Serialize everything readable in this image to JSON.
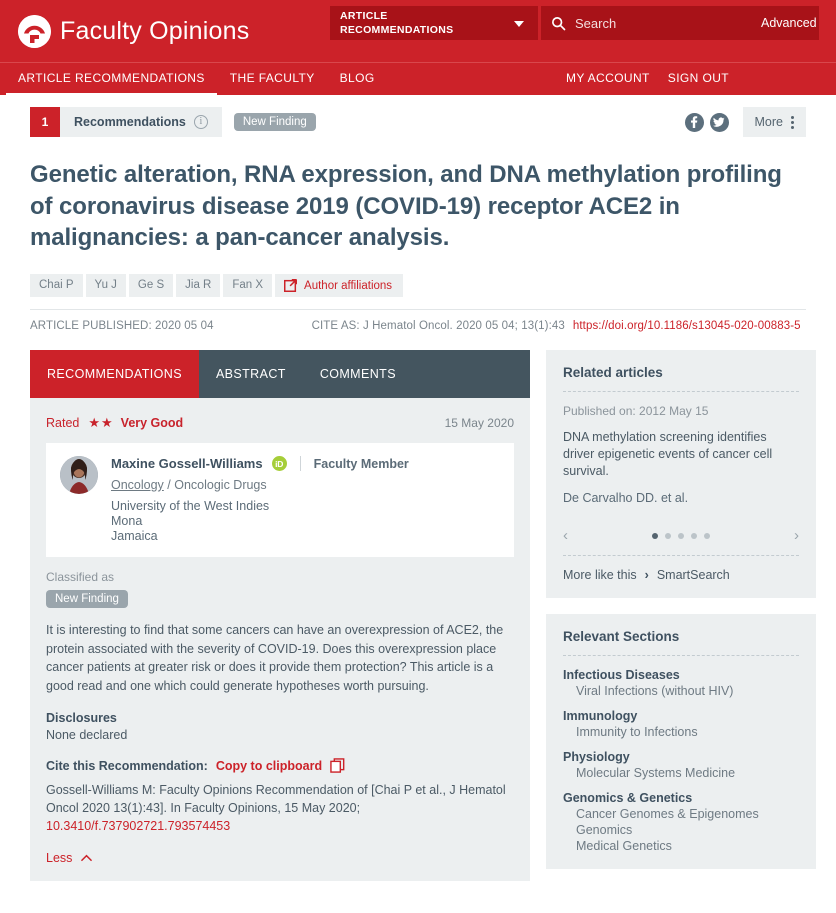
{
  "header": {
    "brand": "Faculty Opinions",
    "logo_icon": "faculty-opinions-logo",
    "dropdown": {
      "line1": "ARTICLE",
      "line2": "RECOMMENDATIONS",
      "caret_icon": "chevron-down-icon"
    },
    "search": {
      "icon": "search-icon",
      "placeholder": "Search",
      "value": "",
      "advanced_label": "Advanced"
    }
  },
  "nav": {
    "items": [
      {
        "label": "ARTICLE RECOMMENDATIONS",
        "active": true
      },
      {
        "label": "THE FACULTY",
        "active": false
      },
      {
        "label": "BLOG",
        "active": false
      }
    ],
    "account": [
      {
        "label": "MY ACCOUNT"
      },
      {
        "label": "SIGN OUT"
      }
    ]
  },
  "recbar": {
    "count": "1",
    "label": "Recommendations",
    "info_icon": "info-icon",
    "tag": "New Finding",
    "facebook_icon": "facebook-icon",
    "twitter_icon": "twitter-icon",
    "more_label": "More",
    "more_icon": "kebab-menu-icon"
  },
  "article": {
    "title": "Genetic alteration, RNA expression, and DNA methylation profiling of coronavirus disease 2019 (COVID-19) receptor ACE2 in malignancies: a pan-cancer analysis.",
    "authors": [
      "Chai P",
      "Yu J",
      "Ge S",
      "Jia R",
      "Fan X"
    ],
    "affiliations_label": "Author affiliations",
    "affiliations_icon": "external-link-icon",
    "published": "ARTICLE PUBLISHED: 2020 05 04",
    "cite_as": "CITE AS: J Hematol Oncol. 2020 05 04; 13(1):43",
    "doi_url": "https://doi.org/10.1186/s13045-020-00883-5"
  },
  "tabs": [
    {
      "label": "RECOMMENDATIONS",
      "active": true
    },
    {
      "label": "ABSTRACT",
      "active": false
    },
    {
      "label": "COMMENTS",
      "active": false
    }
  ],
  "recommendation": {
    "rated_label": "Rated",
    "stars": "★★",
    "rating_value": "Very Good",
    "date": "15 May 2020",
    "reviewer": {
      "avatar": "reviewer-photo",
      "name": "Maxine Gossell-Williams",
      "orcid_icon": "iD",
      "role": "Faculty Member",
      "specialty_primary": "Oncology",
      "specialty_rest": " / Oncologic Drugs",
      "affiliation_line1": "University of the West Indies",
      "affiliation_line2": "Mona",
      "affiliation_line3": "Jamaica"
    },
    "classified_label": "Classified as",
    "classified_tag": "New Finding",
    "body": "It is interesting to find that some cancers can have an overexpression of ACE2, the protein associated with the severity of COVID-19. Does this overexpression place cancer patients at greater risk or does it provide them protection? This article is a good read and one which could generate hypotheses worth pursuing.",
    "disclosures_heading": "Disclosures",
    "disclosures_text": "None declared",
    "cite_heading": "Cite this Recommendation:",
    "copy_link": "Copy to clipboard",
    "copy_icon": "copy-to-clipboard-icon",
    "citation_text": "Gossell-Williams M: Faculty Opinions Recommendation of [Chai P et al., J Hematol Oncol 2020 13(1):43]. In Faculty Opinions, 15 May 2020; ",
    "citation_doi": "10.3410/f.737902721.793574453",
    "less_label": "Less",
    "less_icon": "chevron-up-icon"
  },
  "related_articles": {
    "heading": "Related articles",
    "published_on": "Published on: 2012 May 15",
    "title": "DNA methylation screening identifies driver epigenetic events of cancer cell survival.",
    "authors": "De Carvalho DD. et al.",
    "prev_icon": "chevron-left-icon",
    "next_icon": "chevron-right-icon",
    "dots_total": 5,
    "dot_active": 0,
    "more_like_this": "More like this",
    "more_icon": "chevron-right-icon",
    "smart_search": "SmartSearch"
  },
  "relevant_sections": {
    "heading": "Relevant Sections",
    "groups": [
      {
        "name": "Infectious Diseases",
        "items": [
          "Viral Infections (without HIV)"
        ]
      },
      {
        "name": "Immunology",
        "items": [
          "Immunity to Infections"
        ]
      },
      {
        "name": "Physiology",
        "items": [
          "Molecular Systems Medicine"
        ]
      },
      {
        "name": "Genomics & Genetics",
        "items": [
          "Cancer Genomes & Epigenomes",
          "Genomics",
          "Medical Genetics"
        ]
      }
    ]
  },
  "colors": {
    "brand_red": "#cc2229",
    "dark_red": "#a81218",
    "slate": "#44555f",
    "panel_gray": "#eceff0",
    "tag_gray": "#9aa5ac",
    "orcid_green": "#a6ce39"
  }
}
